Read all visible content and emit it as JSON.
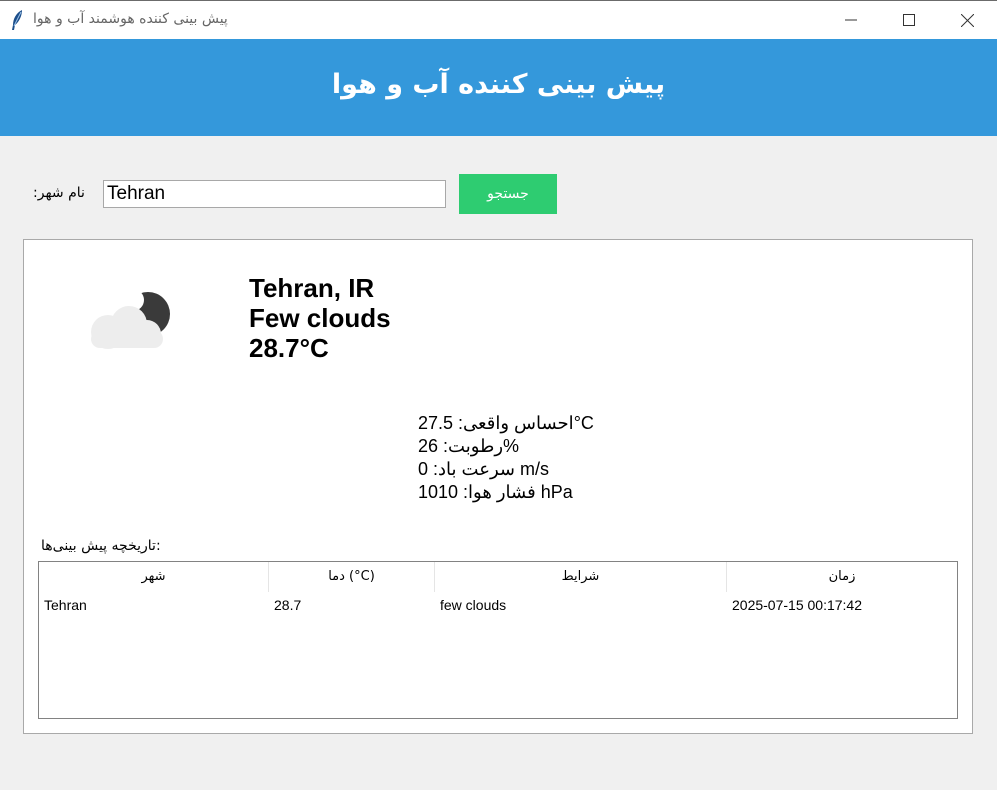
{
  "window": {
    "title": "پیش بینی کننده هوشمند آب و هوا",
    "app_icon": "feather-icon",
    "controls": [
      "minimize-icon",
      "maximize-icon",
      "close-icon"
    ]
  },
  "header": {
    "title": "پیش بینی کننده آب و هوا",
    "background": "#3498db"
  },
  "search": {
    "label": ":نام شهر",
    "value": "Tehran",
    "button_label": "جستجو",
    "button_color": "#2ecc71"
  },
  "current": {
    "icon": "few-clouds-night-icon",
    "city": "Tehran, IR",
    "condition": "Few clouds",
    "temperature": "28.7°C",
    "details": {
      "feels_like": "احساس واقعی: 27.5°C",
      "humidity": "رطوبت: 26%",
      "wind": "سرعت باد: 0 m/s",
      "pressure": "فشار هوا: 1010 hPa"
    }
  },
  "history": {
    "label": "تاریخچه پیش بینی‌ها:",
    "columns": [
      "شهر",
      "دما (°C)",
      "شرایط",
      "زمان"
    ],
    "rows": [
      [
        "Tehran",
        "28.7",
        "few clouds",
        "2025-07-15 00:17:42"
      ]
    ]
  }
}
